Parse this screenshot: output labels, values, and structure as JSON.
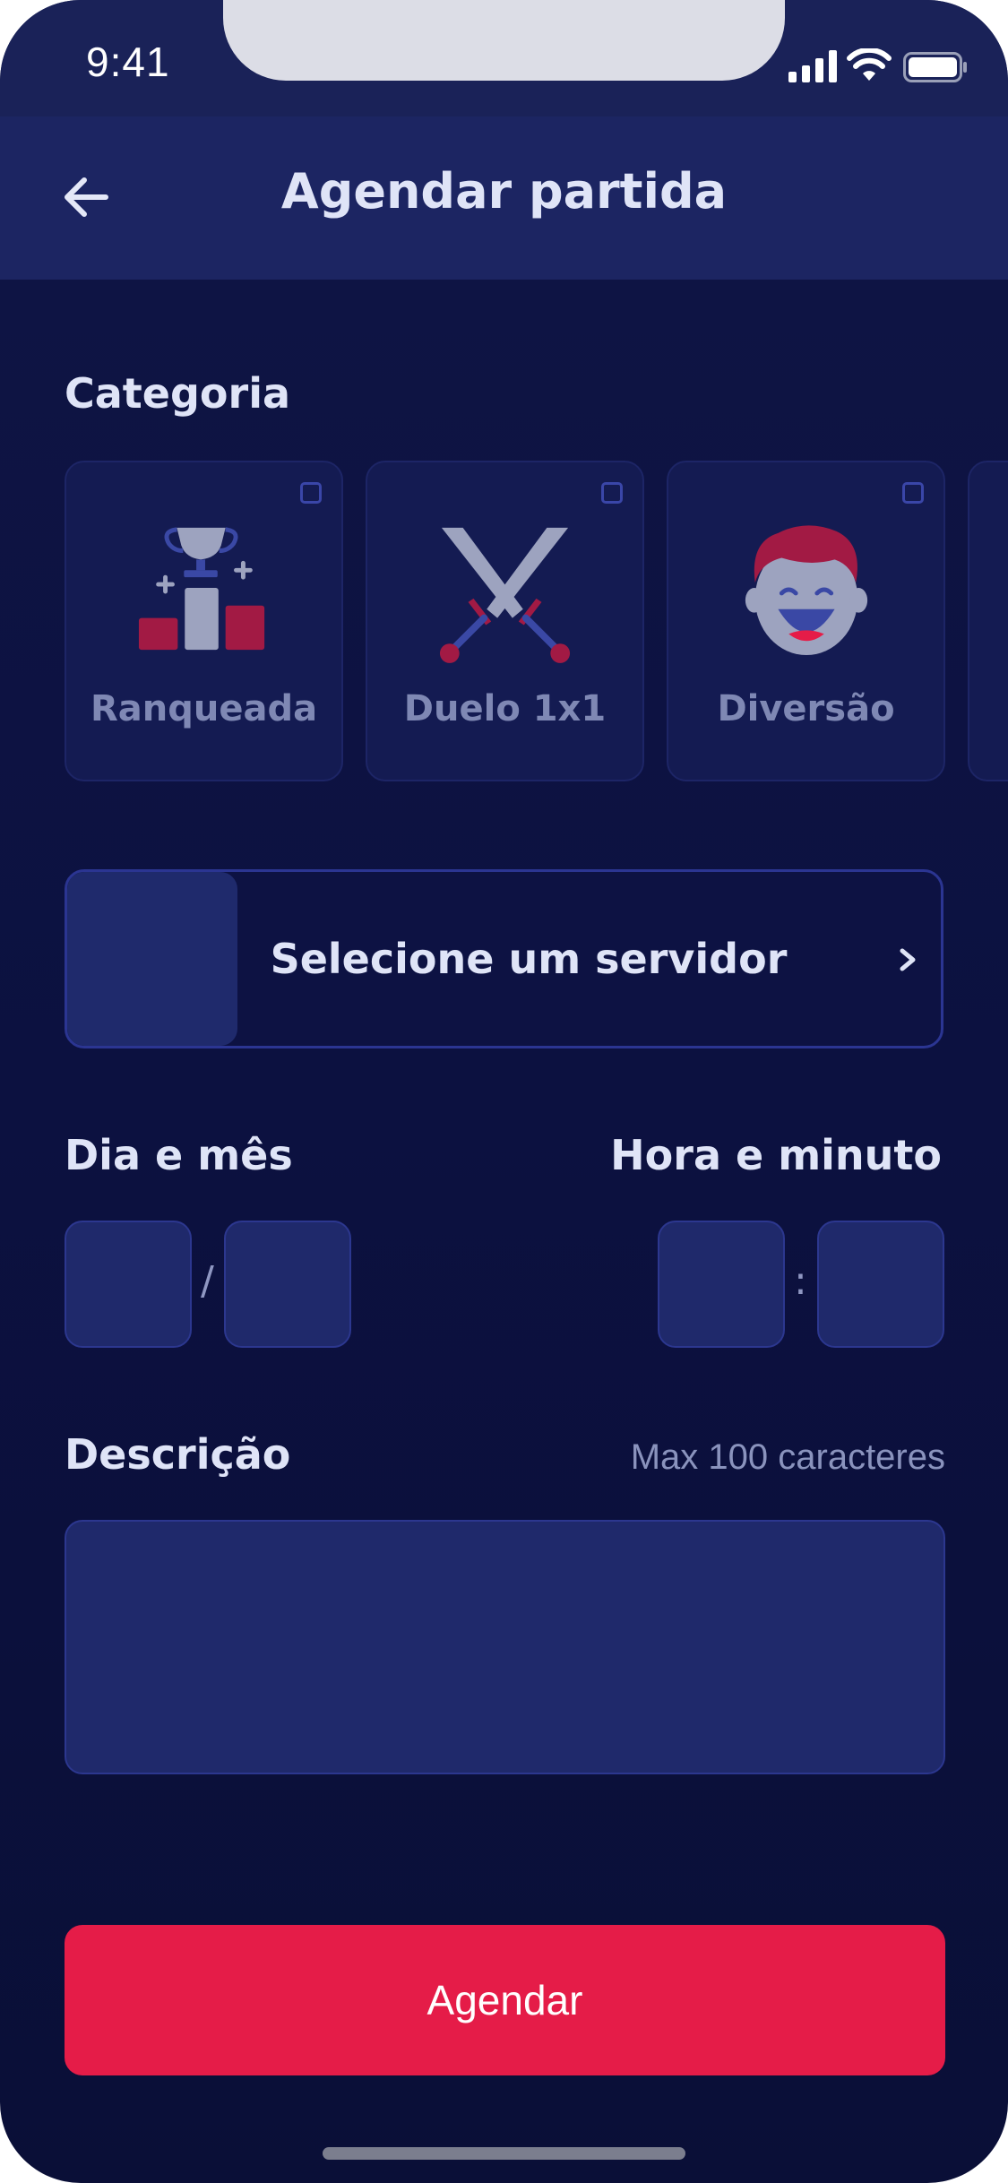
{
  "status_bar": {
    "time": "9:41"
  },
  "header": {
    "title": "Agendar partida",
    "back_icon": "arrow-left-icon"
  },
  "category": {
    "label": "Categoria",
    "items": [
      {
        "label": "Ranqueada",
        "icon": "podium-trophy-icon"
      },
      {
        "label": "Duelo 1x1",
        "icon": "crossed-swords-icon"
      },
      {
        "label": "Diversão",
        "icon": "laughing-face-icon"
      }
    ]
  },
  "server": {
    "label": "Selecione um servidor"
  },
  "date": {
    "label": "Dia e mês",
    "separator": "/"
  },
  "time": {
    "label": "Hora e minuto",
    "separator": ":"
  },
  "description": {
    "label": "Descrição",
    "hint": "Max 100 caracteres"
  },
  "submit": {
    "label": "Agendar"
  },
  "colors": {
    "accent": "#e51c48",
    "background": "#0c1140",
    "header": "#1c2562"
  }
}
